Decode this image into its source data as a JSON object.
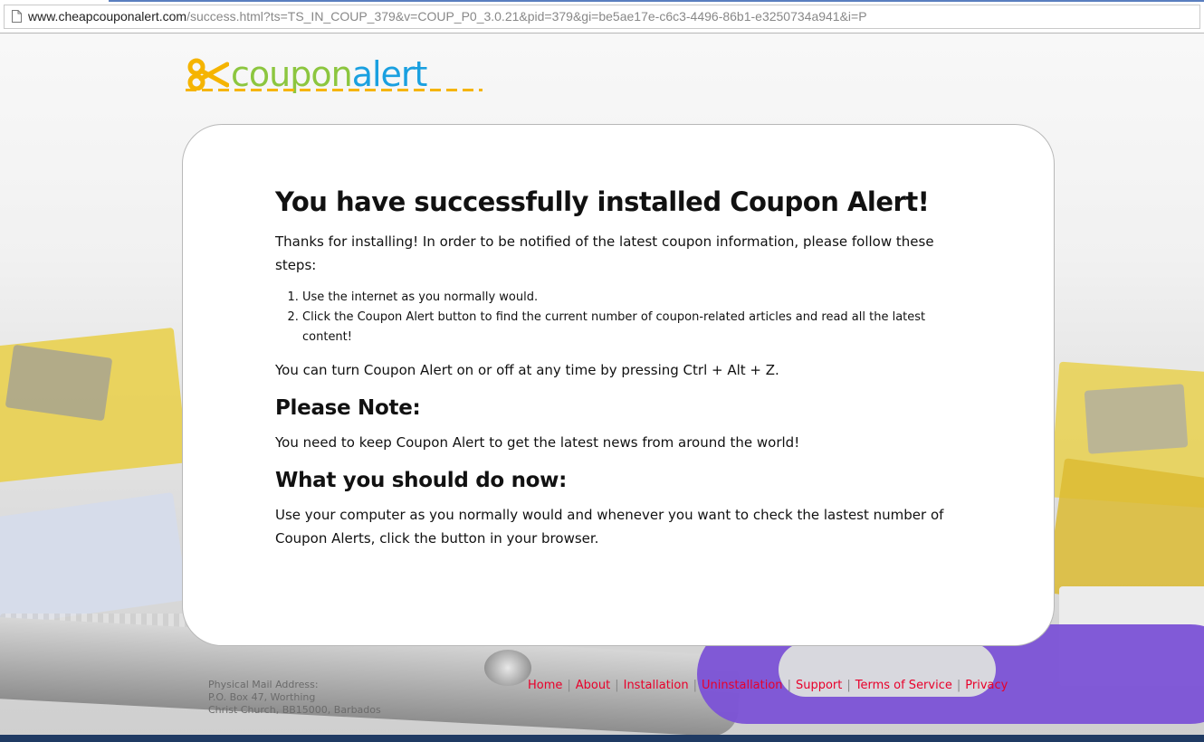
{
  "browser": {
    "url_domain": "www.cheapcouponalert.com",
    "url_rest": "/success.html?ts=TS_IN_COUP_379&v=COUP_P0_3.0.21&pid=379&gi=be5ae17e-c6c3-4496-86b1-e3250734a941&i=P"
  },
  "logo": {
    "part1": "coupon",
    "part2": "alert",
    "color1": "#8cc63f",
    "color2": "#1aa0e0",
    "icon": "scissors-icon"
  },
  "main": {
    "title": "You have successfully installed Coupon Alert!",
    "intro": "Thanks for installing! In order to be notified of the latest coupon information, please follow these steps:",
    "steps": [
      "Use the internet as you normally would.",
      "Click the Coupon Alert button to find the current number of coupon-related articles and read all the latest content!"
    ],
    "toggle_text": "You can turn Coupon Alert on or off at any time by pressing Ctrl + Alt + Z.",
    "note_heading": "Please Note:",
    "note_text": "You need to keep Coupon Alert to get the latest news from around the world!",
    "todo_heading": "What you should do now:",
    "todo_text": "Use your computer as you normally would and whenever you want to check the lastest number of Coupon Alerts, click the button in your browser."
  },
  "footer": {
    "address_lines": [
      "Physical Mail Address:",
      "P.O. Box 47, Worthing",
      "Christ Church, BB15000, Barbados"
    ],
    "links": [
      "Home",
      "About",
      "Installation",
      "Uninstallation",
      "Support",
      "Terms of Service",
      "Privacy"
    ],
    "link_color": "#e8002a"
  }
}
